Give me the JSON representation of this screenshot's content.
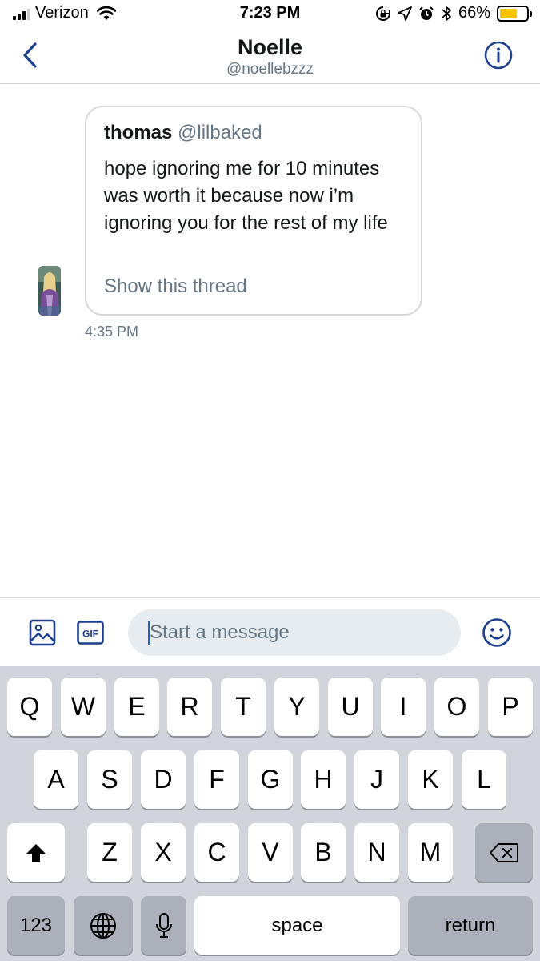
{
  "status_bar": {
    "carrier": "Verizon",
    "time": "7:23 PM",
    "battery_percent": "66%",
    "battery_level": 0.66,
    "icons": [
      "signal-icon",
      "wifi-icon",
      "rotation-lock-icon",
      "location-icon",
      "alarm-icon",
      "bluetooth-icon",
      "battery-icon"
    ]
  },
  "header": {
    "title": "Noelle",
    "handle": "@noellebzzz",
    "back_icon": "chevron-left-icon",
    "info_icon": "info-icon"
  },
  "conversation": {
    "messages": [
      {
        "type": "shared-tweet",
        "tweet": {
          "author_name": "thomas",
          "author_handle": "@lilbaked",
          "text": "hope ignoring me for 10 minutes was worth it because now i’m ignoring you for the rest of my life",
          "thread_link": "Show this thread"
        },
        "time": "4:35 PM"
      }
    ]
  },
  "compose": {
    "placeholder": "Start a message",
    "media_icon": "image-icon",
    "gif_label": "GIF",
    "emoji_icon": "emoji-icon"
  },
  "keyboard": {
    "row1": [
      "Q",
      "W",
      "E",
      "R",
      "T",
      "Y",
      "U",
      "I",
      "O",
      "P"
    ],
    "row2": [
      "A",
      "S",
      "D",
      "F",
      "G",
      "H",
      "J",
      "K",
      "L"
    ],
    "row3": [
      "Z",
      "X",
      "C",
      "V",
      "B",
      "N",
      "M"
    ],
    "numbers_label": "123",
    "space_label": "space",
    "return_label": "return",
    "shift_icon": "shift-icon",
    "delete_icon": "backspace-icon",
    "globe_icon": "globe-icon",
    "mic_icon": "microphone-icon"
  },
  "colors": {
    "accent": "#1d3f8f",
    "secondary_text": "#657786",
    "battery": "#f6c400",
    "input_bg": "#e6ecf0",
    "keyboard_bg": "#d1d4da"
  }
}
